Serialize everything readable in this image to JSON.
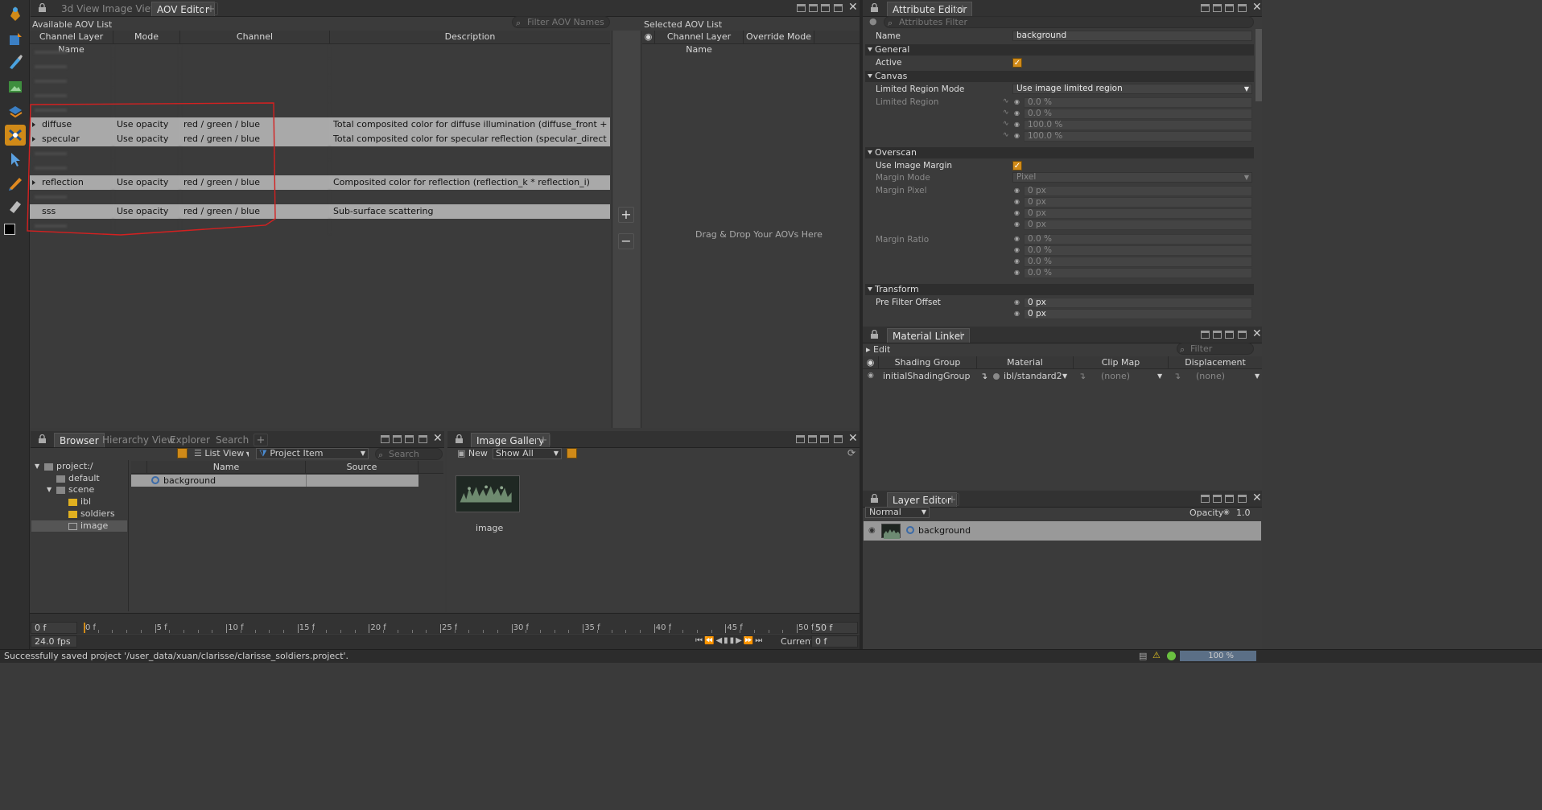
{
  "toolbar": {
    "tools": [
      "clarisse-logo-icon",
      "transform-icon",
      "brush-icon",
      "image-icon",
      "layer-icon",
      "paint-icon",
      "select-arrow-icon",
      "pen-icon",
      "eraser-icon",
      "color-swatch-icon"
    ]
  },
  "top_left_tabs": [
    "3d View",
    "Image View",
    "AOV Editor"
  ],
  "aov": {
    "available_title": "Available AOV List",
    "filter_placeholder": "Filter AOV Names",
    "columns": [
      "Channel Layer Name",
      "Mode",
      "Channel",
      "Description"
    ],
    "rows": [
      {
        "name": "",
        "mode": "",
        "channel": "",
        "desc": "",
        "dim": true
      },
      {
        "name": "",
        "mode": "",
        "channel": "",
        "desc": "",
        "dim": true
      },
      {
        "name": "",
        "mode": "",
        "channel": "",
        "desc": "",
        "dim": true
      },
      {
        "name": "",
        "mode": "",
        "channel": "",
        "desc": "",
        "dim": true
      },
      {
        "name": "",
        "mode": "",
        "channel": "",
        "desc": "",
        "dim": true
      },
      {
        "name": "diffuse",
        "mode": "Use opacity",
        "channel": "red / green / blue",
        "desc": "Total composited color for diffuse illumination (diffuse_front + diffuse_...",
        "sel": true,
        "expand": true
      },
      {
        "name": "specular",
        "mode": "Use opacity",
        "channel": "red / green / blue",
        "desc": "Total composited color for specular reflection (specular_direct + specul...",
        "sel": true,
        "expand": true
      },
      {
        "name": "",
        "mode": "",
        "channel": "",
        "desc": "",
        "dim": true
      },
      {
        "name": "",
        "mode": "",
        "channel": "",
        "desc": "",
        "dim": true
      },
      {
        "name": "reflection",
        "mode": "Use opacity",
        "channel": "red / green / blue",
        "desc": "Composited color for reflection (reflection_k * reflection_i)",
        "sel": true,
        "expand": true
      },
      {
        "name": "",
        "mode": "",
        "channel": "",
        "desc": "",
        "dim": true
      },
      {
        "name": "sss",
        "mode": "Use opacity",
        "channel": "red / green / blue",
        "desc": "Sub-surface scattering",
        "sel": true,
        "expand": false
      },
      {
        "name": "",
        "mode": "",
        "channel": "",
        "desc": "",
        "dim": true
      }
    ],
    "selected_title": "Selected AOV List",
    "selected_columns": [
      "Channel Layer Name",
      "Override Mode"
    ],
    "drop_hint": "Drag & Drop Your AOVs Here"
  },
  "attr": {
    "tab": "Attribute Editor",
    "filter_placeholder": "Attributes Filter",
    "name_label": "Name",
    "name_value": "background",
    "sections": {
      "general": "General",
      "canvas": "Canvas",
      "overscan": "Overscan",
      "transform": "Transform"
    },
    "active_label": "Active",
    "limited_mode_label": "Limited Region Mode",
    "limited_mode_value": "Use image limited region",
    "limited_region_label": "Limited Region",
    "limited_region_values": [
      "0.0 %",
      "0.0 %",
      "100.0 %",
      "100.0 %"
    ],
    "use_margin_label": "Use Image Margin",
    "margin_mode_label": "Margin Mode",
    "margin_mode_value": "Pixel",
    "margin_pixel_label": "Margin Pixel",
    "margin_pixel_values": [
      "0 px",
      "0 px",
      "0 px",
      "0 px"
    ],
    "margin_ratio_label": "Margin Ratio",
    "margin_ratio_values": [
      "0.0 %",
      "0.0 %",
      "0.0 %",
      "0.0 %"
    ],
    "pre_filter_label": "Pre Filter Offset",
    "pre_filter_values": [
      "0 px",
      "0 px"
    ]
  },
  "material": {
    "tab": "Material Linker",
    "edit": "Edit",
    "filter_placeholder": "Filter",
    "columns": [
      "Shading Group",
      "Material",
      "Clip Map",
      "Displacement"
    ],
    "row": {
      "group": "initialShadingGroup",
      "material": "ibl/standard2",
      "clip": "(none)",
      "disp": "(none)"
    }
  },
  "browser": {
    "tabs": [
      "Browser",
      "Hierarchy View",
      "Explorer",
      "Search"
    ],
    "view": "List View",
    "item_type": "Project Item",
    "search_placeholder": "Search Items",
    "tree": [
      {
        "label": "project:/",
        "depth": 0
      },
      {
        "label": "default",
        "depth": 1
      },
      {
        "label": "scene",
        "depth": 1
      },
      {
        "label": "ibl",
        "depth": 2
      },
      {
        "label": "soldiers",
        "depth": 2
      },
      {
        "label": "image",
        "depth": 2
      }
    ],
    "columns": [
      "Name",
      "Source"
    ],
    "item": "background"
  },
  "gallery": {
    "tab": "Image Gallery",
    "new_label": "New",
    "show": "Show All",
    "thumb_label": "image"
  },
  "layer": {
    "tab": "Layer Editor",
    "blend": "Normal",
    "opacity_label": "Opacity",
    "opacity_value": "1.0",
    "layer_name": "background"
  },
  "timeline": {
    "start": "0 f",
    "end": "50 f",
    "ticks": [
      "0 f",
      "5 f",
      "10 f",
      "15 f",
      "20 f",
      "25 f",
      "30 f",
      "35 f",
      "40 f",
      "45 f",
      "50 f"
    ],
    "fps": "24.0 fps",
    "current_label": "Current",
    "current_value": "0 f"
  },
  "status": {
    "message": "Successfully saved project '/user_data/xuan/clarisse/clarisse_soldiers.project'.",
    "zoom": "100 %"
  },
  "colors": {
    "accent": "#d08a18",
    "annotation": "#d42020",
    "selection": "#a9a9a9"
  }
}
